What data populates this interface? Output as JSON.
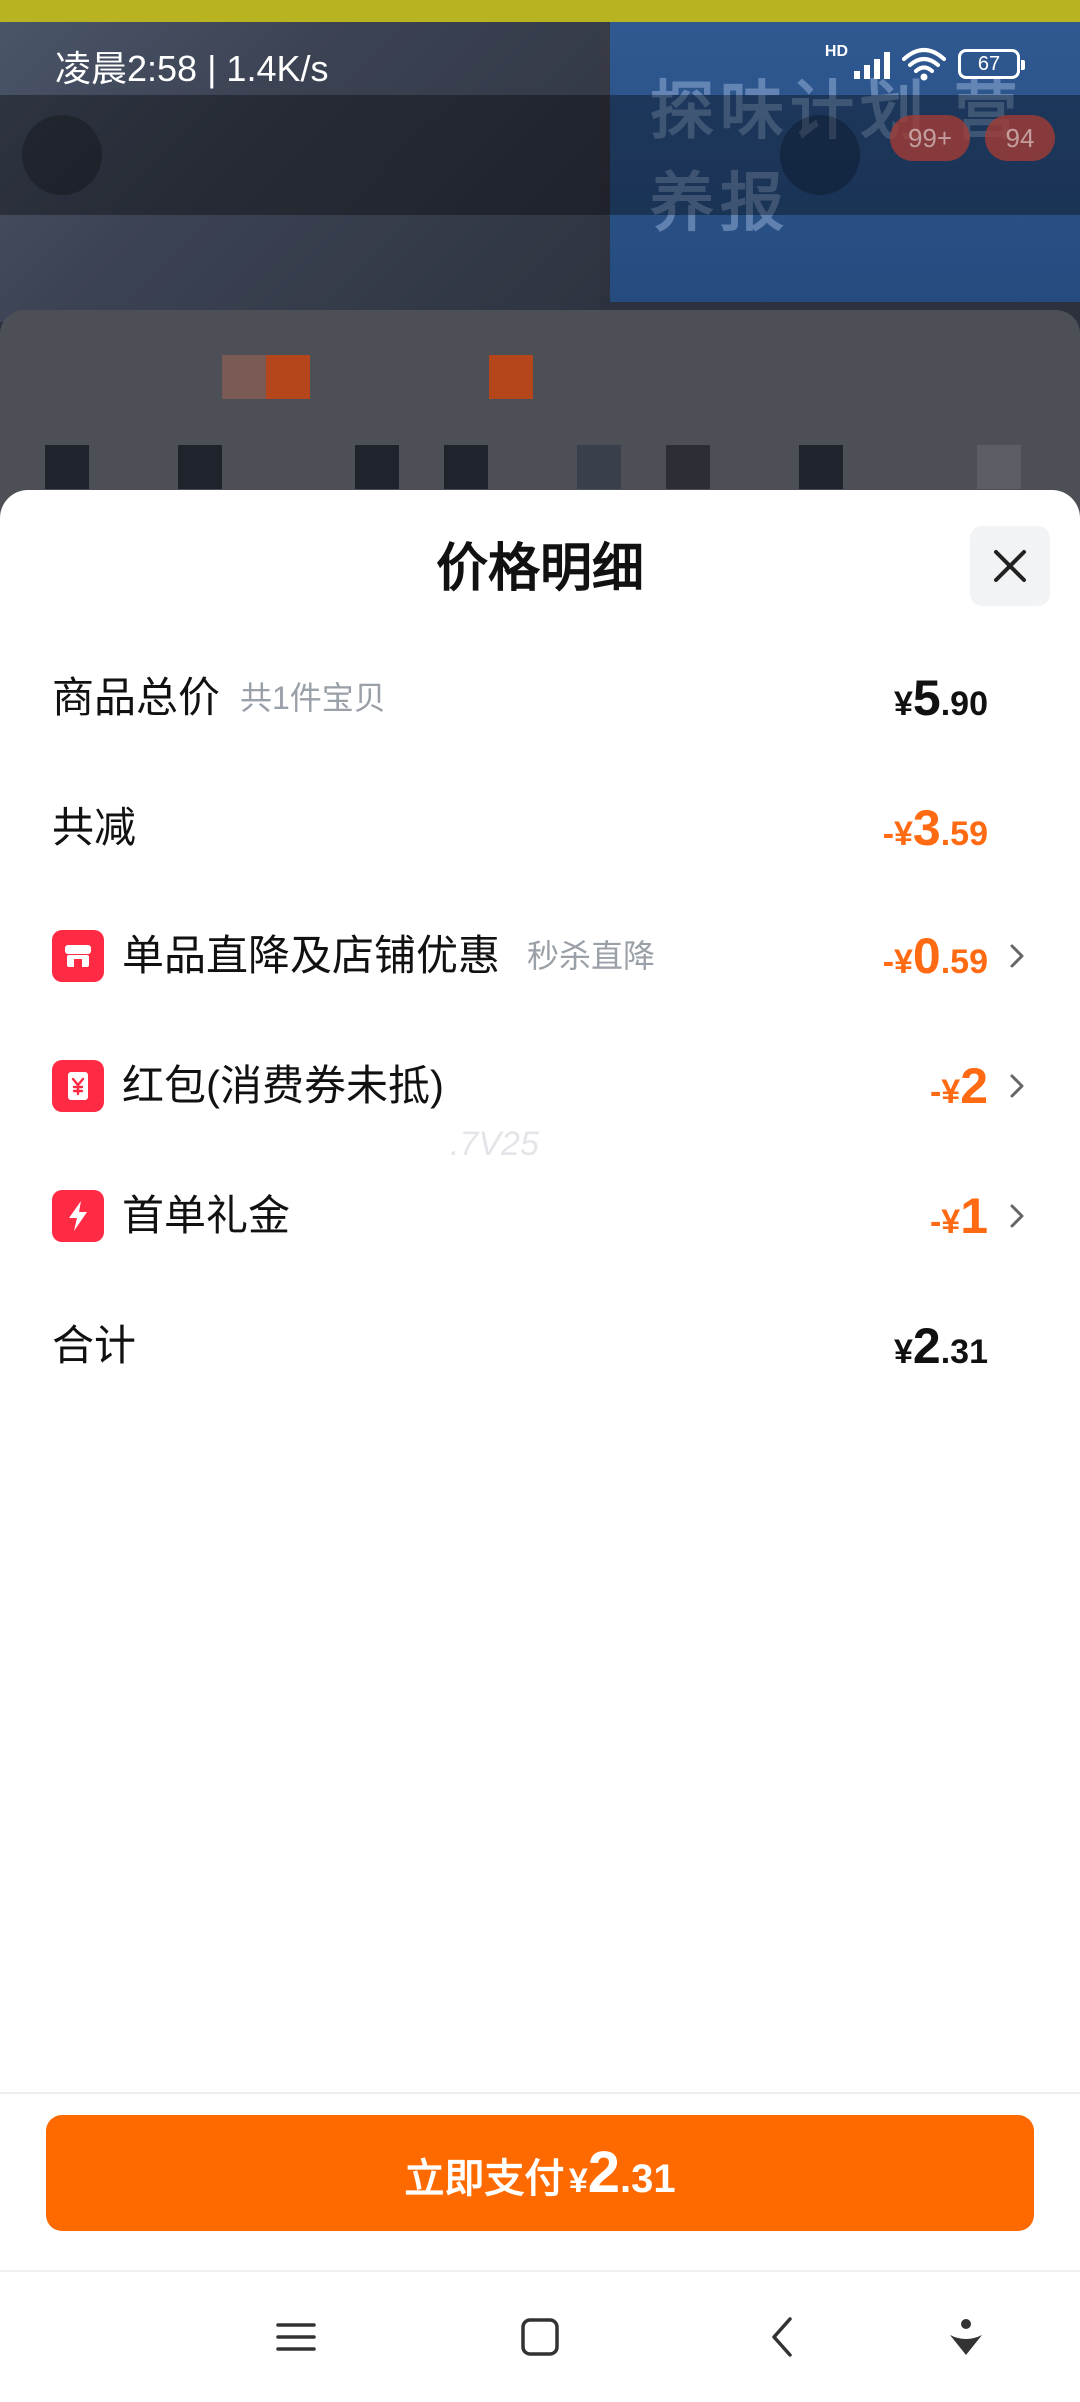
{
  "status_bar": {
    "time_speed": "凌晨2:58 | 1.4K/s",
    "hd_label": "HD",
    "battery": "67"
  },
  "background": {
    "badge_left": "99+",
    "badge_right": "94",
    "banner_text": "探味计划 营养报"
  },
  "sheet": {
    "title": "价格明细",
    "rows": [
      {
        "label": "商品总价",
        "sub": "共1件宝贝",
        "symbol": "¥",
        "int": "5",
        "dec": ".90"
      },
      {
        "label": "共减",
        "symbol": "-¥",
        "int": "3",
        "dec": ".59"
      },
      {
        "label": "单品直降及店铺优惠",
        "sub": "秒杀直降",
        "symbol": "-¥",
        "int": "0",
        "dec": ".59",
        "icon": "store-icon"
      },
      {
        "label": "红包(消费券未抵)",
        "symbol": "-¥",
        "int": "2",
        "dec": "",
        "icon": "red-packet-icon"
      },
      {
        "label": "首单礼金",
        "symbol": "-¥",
        "int": "1",
        "dec": "",
        "icon": "lightning-icon"
      },
      {
        "label": "合计",
        "symbol": "¥",
        "int": "2",
        "dec": ".31"
      }
    ],
    "watermark": ".7V25"
  },
  "pay_button": {
    "label": "立即支付",
    "symbol": "¥",
    "int": "2",
    "dec": ".31"
  },
  "colors": {
    "accent": "#ff6a00",
    "discount": "#ff6a12",
    "icon_red": "#ff2b45"
  }
}
